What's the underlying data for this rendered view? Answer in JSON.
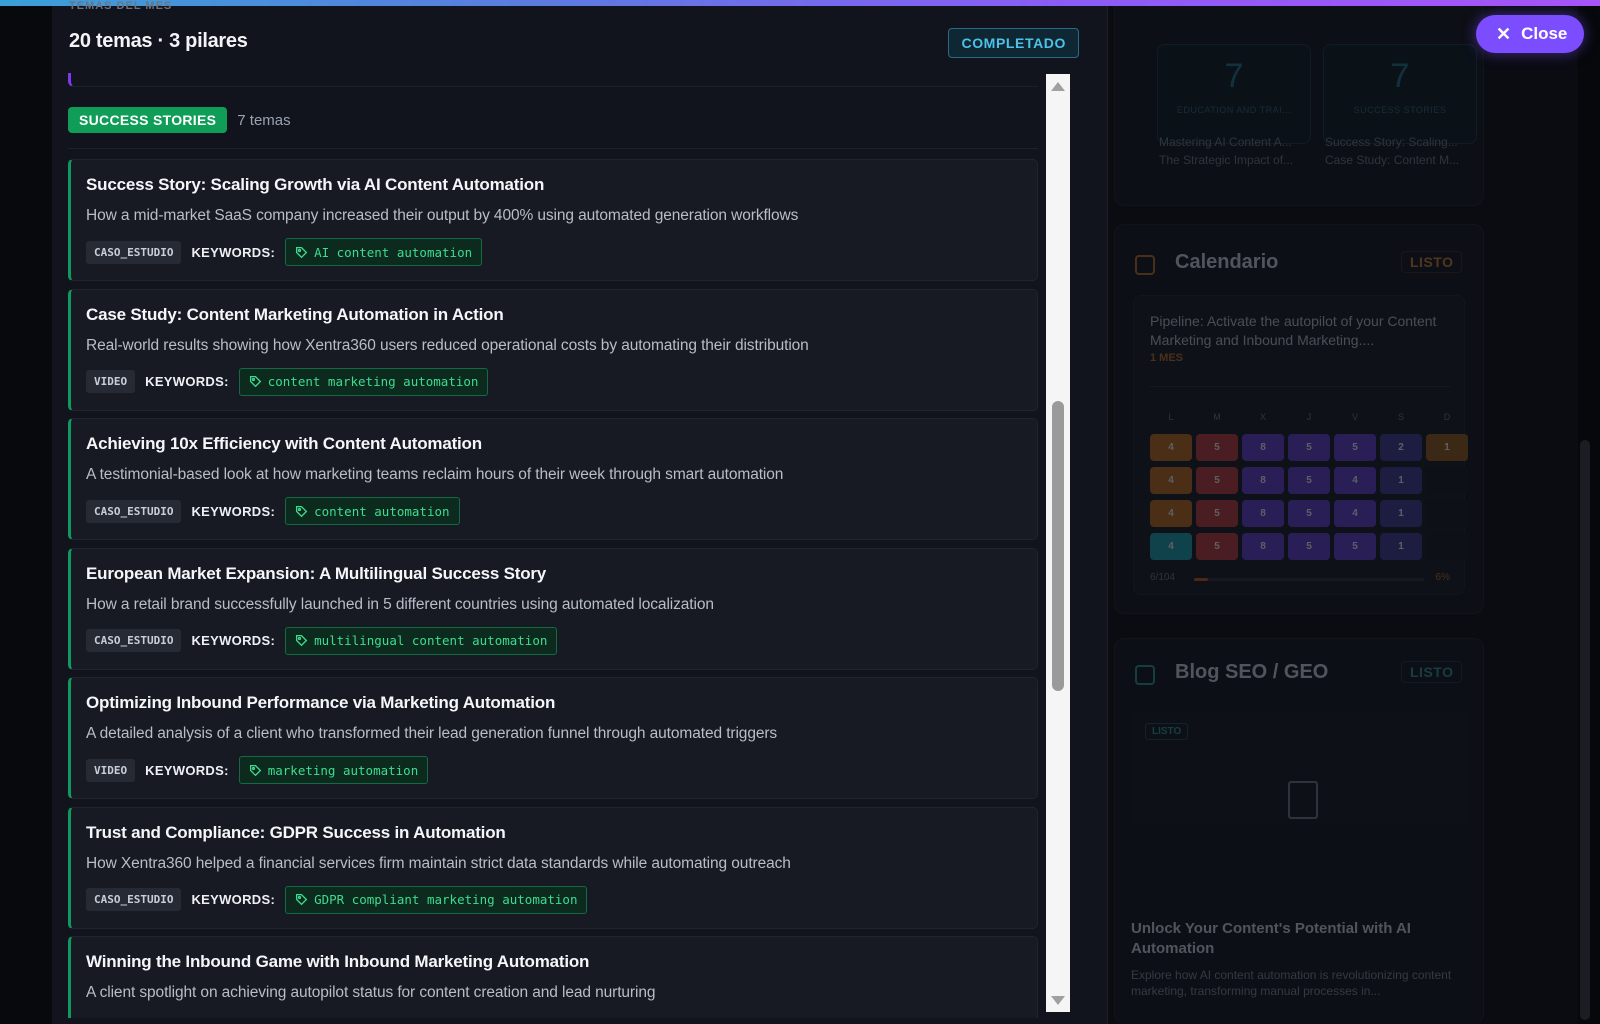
{
  "modal": {
    "kicker": "TEMAS DEL MES",
    "title": "20 temas · 3 pilares",
    "status": "COMPLETADO"
  },
  "pillar": {
    "name": "SUCCESS STORIES",
    "count": "7 temas"
  },
  "keywords_label": "KEYWORDS:",
  "topics": [
    {
      "title": "Success Story: Scaling Growth via AI Content Automation",
      "description": "How a mid-market SaaS company increased their output by 400% using automated generation workflows",
      "type": "CASO_ESTUDIO",
      "keyword": "AI content automation"
    },
    {
      "title": "Case Study: Content Marketing Automation in Action",
      "description": "Real-world results showing how Xentra360 users reduced operational costs by automating their distribution",
      "type": "VIDEO",
      "keyword": "content marketing automation"
    },
    {
      "title": "Achieving 10x Efficiency with Content Automation",
      "description": "A testimonial-based look at how marketing teams reclaim hours of their week through smart automation",
      "type": "CASO_ESTUDIO",
      "keyword": "content automation"
    },
    {
      "title": "European Market Expansion: A Multilingual Success Story",
      "description": "How a retail brand successfully launched in 5 different countries using automated localization",
      "type": "CASO_ESTUDIO",
      "keyword": "multilingual content automation"
    },
    {
      "title": "Optimizing Inbound Performance via Marketing Automation",
      "description": "A detailed analysis of a client who transformed their lead generation funnel through automated triggers",
      "type": "VIDEO",
      "keyword": "marketing automation"
    },
    {
      "title": "Trust and Compliance: GDPR Success in Automation",
      "description": "How Xentra360 helped a financial services firm maintain strict data standards while automating outreach",
      "type": "CASO_ESTUDIO",
      "keyword": "GDPR compliant marketing automation"
    },
    {
      "title": "Winning the Inbound Game with Inbound Marketing Automation",
      "description": "A client spotlight on achieving autopilot status for content creation and lead nurturing",
      "type": "",
      "keyword": ""
    }
  ],
  "close_button": "Close",
  "right_panel": {
    "stats": [
      {
        "number": "7",
        "label": "EDUCATION AND TRAI...",
        "lines": [
          "Mastering AI Content A...",
          "The Strategic Impact of..."
        ]
      },
      {
        "number": "7",
        "label": "SUCCESS STORIES",
        "lines": [
          "Success Story: Scaling...",
          "Case Study: Content M..."
        ]
      }
    ],
    "calendar": {
      "title": "Calendario",
      "status": "LISTO",
      "pipeline": "Pipeline: Activate the autopilot of your Content Marketing and Inbound Marketing....",
      "duration": "1 MES",
      "weekdays": [
        "L",
        "M",
        "X",
        "J",
        "V",
        "S",
        "D"
      ],
      "rows": [
        [
          "4",
          "5",
          "8",
          "5",
          "5",
          "2",
          "1"
        ],
        [
          "4",
          "5",
          "8",
          "5",
          "4",
          "1",
          ""
        ],
        [
          "4",
          "5",
          "8",
          "5",
          "4",
          "1",
          ""
        ],
        [
          "4",
          "5",
          "8",
          "5",
          "5",
          "1",
          ""
        ]
      ],
      "progress_text": "6/104",
      "progress_pct": "6%",
      "progress": 0.06
    },
    "blog": {
      "title": "Blog SEO / GEO",
      "status": "LISTO",
      "badge": "LISTO",
      "headline": "Unlock Your Content's Potential with AI Automation",
      "excerpt": "Explore how AI content automation is revolutionizing content marketing, transforming manual processes in..."
    }
  },
  "colors": {
    "accent_green": "#0e9a5e",
    "accent_purple": "#7c4dff",
    "status_blue": "#4fc1e9"
  }
}
